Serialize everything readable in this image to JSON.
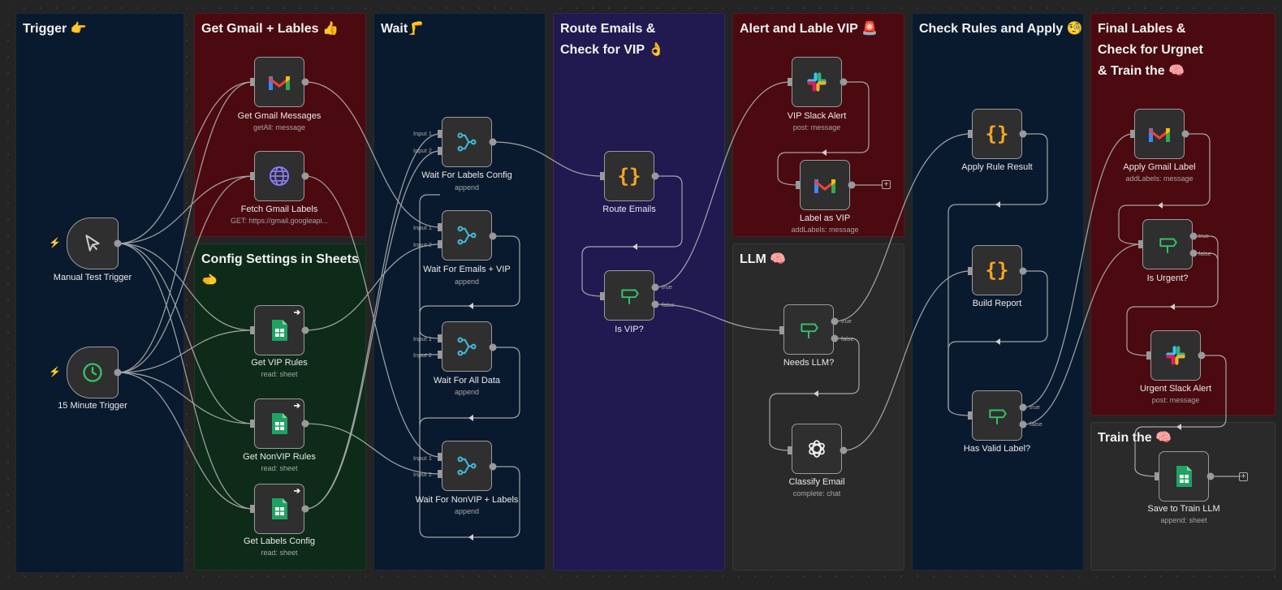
{
  "sections": {
    "trigger": "Trigger 👉",
    "gmail": "Get Gmail + Lables 👍",
    "config": "Config Settings in Sheets\n🫲",
    "wait": "Wait🦵",
    "route": "Route Emails &\nCheck for VIP 👌",
    "alert": "Alert and Lable VIP 🚨",
    "llm": "LLM 🧠",
    "rules": "Check Rules and Apply 🧐",
    "final": "Final Lables &\nCheck for Urgnet\n& Train the 🧠",
    "train": "Train the 🧠"
  },
  "nodes": {
    "manual_trigger": {
      "label": "Manual Test Trigger"
    },
    "timer_trigger": {
      "label": "15 Minute Trigger"
    },
    "get_gmail": {
      "label": "Get Gmail Messages",
      "sub": "getAll: message"
    },
    "fetch_labels": {
      "label": "Fetch Gmail Labels",
      "sub": "GET: https://gmail.googleapi..."
    },
    "get_vip_rules": {
      "label": "Get VIP Rules",
      "sub": "read: sheet"
    },
    "get_nonvip_rules": {
      "label": "Get NonVIP Rules",
      "sub": "read: sheet"
    },
    "get_labels_config": {
      "label": "Get Labels Config",
      "sub": "read: sheet"
    },
    "wait_labels_config": {
      "label": "Wait For Labels Config",
      "sub": "append"
    },
    "wait_emails_vip": {
      "label": "Wait For Emails + VIP",
      "sub": "append"
    },
    "wait_all_data": {
      "label": "Wait For All Data",
      "sub": "append"
    },
    "wait_nonvip_labels": {
      "label": "Wait For NonVIP + Labels",
      "sub": "append"
    },
    "route_emails": {
      "label": "Route Emails"
    },
    "is_vip": {
      "label": "Is VIP?"
    },
    "vip_slack": {
      "label": "VIP Slack Alert",
      "sub": "post: message"
    },
    "label_vip": {
      "label": "Label as VIP",
      "sub": "addLabels: message"
    },
    "needs_llm": {
      "label": "Needs LLM?"
    },
    "classify_email": {
      "label": "Classify Email",
      "sub": "complete: chat"
    },
    "apply_rule": {
      "label": "Apply Rule Result"
    },
    "build_report": {
      "label": "Build Report"
    },
    "has_valid_label": {
      "label": "Has Valid Label?"
    },
    "apply_gmail_label": {
      "label": "Apply Gmail Label",
      "sub": "addLabels: message"
    },
    "is_urgent": {
      "label": "Is Urgent?"
    },
    "urgent_slack": {
      "label": "Urgent Slack Alert",
      "sub": "post: message"
    },
    "save_train": {
      "label": "Save to Train LLM",
      "sub": "append: sheet"
    }
  },
  "ports": {
    "input1": "Input 1",
    "input2": "Input 2",
    "true": "true",
    "false": "false"
  },
  "icons": {
    "trigger": "cursor-icon",
    "timer": "clock-icon",
    "gmail": "gmail-icon",
    "http": "globe-icon",
    "sheets": "google-sheets-icon",
    "merge": "merge-icon",
    "code": "code-braces-icon",
    "if": "if-signpost-icon",
    "slack": "slack-icon",
    "openai": "openai-icon"
  },
  "colors": {
    "canvas": "#242424",
    "section_navy": "#0a1a2e",
    "section_red": "#4a0a10",
    "section_green": "#0e2b1a",
    "section_purple": "#211a50",
    "section_gray": "#2a2a2a",
    "code_accent": "#f5a623",
    "if_accent": "#35c26b",
    "merge_accent": "#3fb8d8",
    "http_accent": "#8b7cf6",
    "trigger_bolt": "#e04848"
  }
}
